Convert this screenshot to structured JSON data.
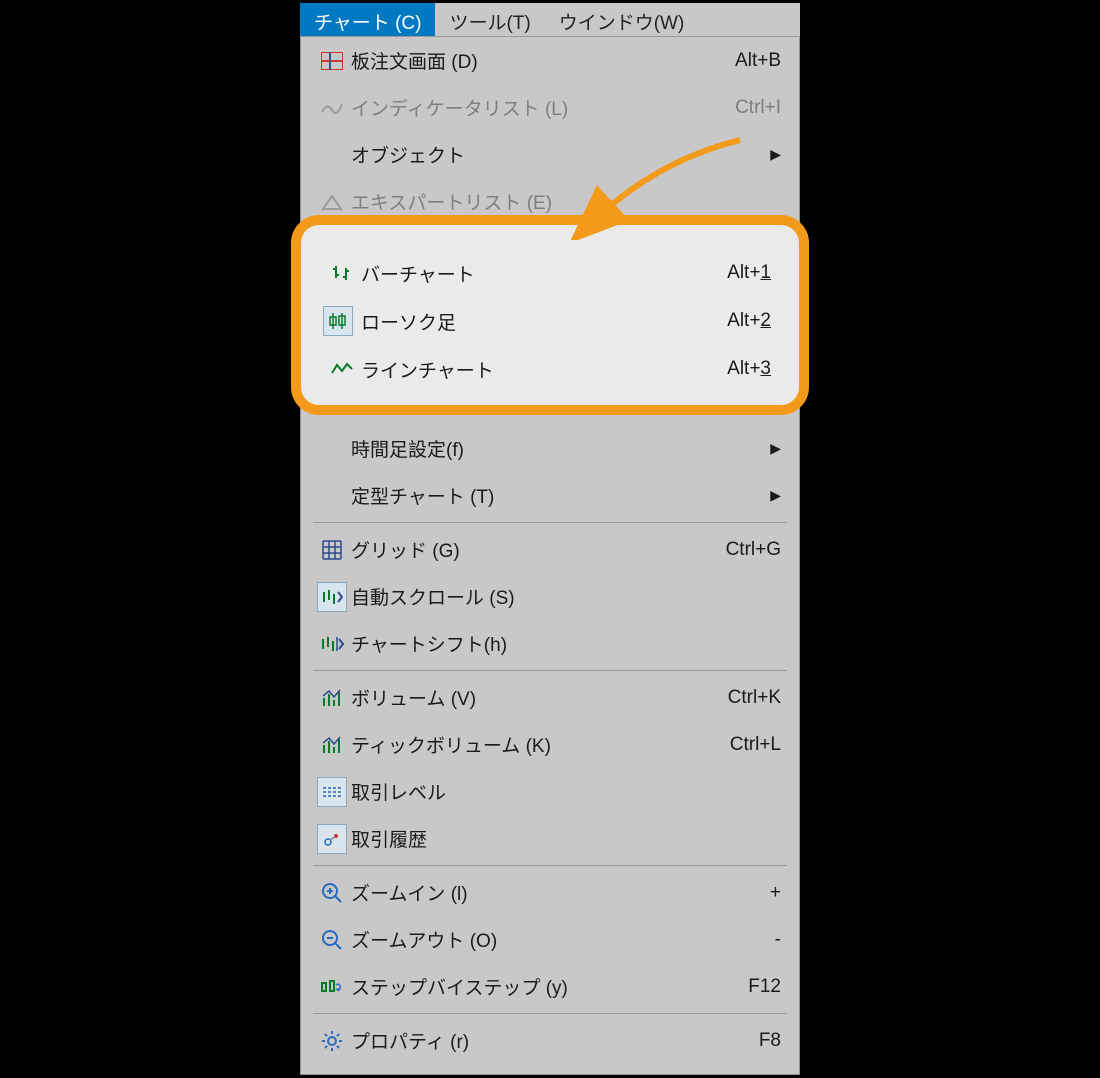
{
  "menubar": {
    "chart": "チャート (C)",
    "tool": "ツール(T)",
    "window": "ウインドウ(W)"
  },
  "menu": {
    "board_order": {
      "label": "板注文画面 (D)",
      "shortcut": "Alt+B"
    },
    "indicator_list": {
      "label": "インディケータリスト (L)",
      "shortcut": "Ctrl+I"
    },
    "object": {
      "label": "オブジェクト"
    },
    "expert_list": {
      "label": "エキスパートリスト (E)"
    },
    "bar_chart": {
      "label": "バーチャート",
      "shortcut_prefix": "Alt+",
      "shortcut_key": "1"
    },
    "candle": {
      "label": "ローソク足",
      "shortcut_prefix": "Alt+",
      "shortcut_key": "2"
    },
    "line_chart": {
      "label": "ラインチャート",
      "shortcut_prefix": "Alt+",
      "shortcut_key": "3"
    },
    "timeframe": {
      "label": "時間足設定(f)"
    },
    "template": {
      "label": "定型チャート (T)"
    },
    "grid": {
      "label": "グリッド (G)",
      "shortcut": "Ctrl+G"
    },
    "autoscroll": {
      "label": "自動スクロール (S)"
    },
    "chartshift": {
      "label": "チャートシフト(h)"
    },
    "volume": {
      "label": "ボリューム (V)",
      "shortcut": "Ctrl+K"
    },
    "tickvolume": {
      "label": "ティックボリューム (K)",
      "shortcut": "Ctrl+L"
    },
    "tradelevels": {
      "label": "取引レベル"
    },
    "tradehistory": {
      "label": "取引履歴"
    },
    "zoomin": {
      "label": "ズームイン (l)",
      "shortcut": "+"
    },
    "zoomout": {
      "label": "ズームアウト (O)",
      "shortcut": "-"
    },
    "stepbystep": {
      "label": "ステップバイステップ (y)",
      "shortcut": "F12"
    },
    "property": {
      "label": "プロパティ (r)",
      "shortcut": "F8"
    }
  }
}
